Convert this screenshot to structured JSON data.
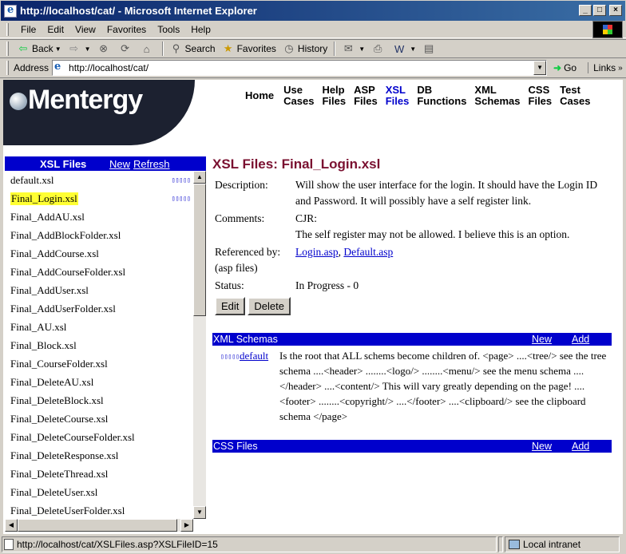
{
  "window": {
    "title": "http://localhost/cat/ - Microsoft Internet Explorer"
  },
  "menu": [
    "File",
    "Edit",
    "View",
    "Favorites",
    "Tools",
    "Help"
  ],
  "toolbar": {
    "back": "Back",
    "search": "Search",
    "favorites": "Favorites",
    "history": "History"
  },
  "address": {
    "label": "Address",
    "url": "http://localhost/cat/",
    "go": "Go",
    "links": "Links"
  },
  "logo": {
    "text": "Mentergy"
  },
  "nav": [
    {
      "line1": "Home",
      "line2": ""
    },
    {
      "line1": "Use",
      "line2": "Cases"
    },
    {
      "line1": "Help",
      "line2": "Files"
    },
    {
      "line1": "ASP",
      "line2": "Files"
    },
    {
      "line1": "XSL",
      "line2": "Files"
    },
    {
      "line1": "DB",
      "line2": "Functions"
    },
    {
      "line1": "XML",
      "line2": "Schemas"
    },
    {
      "line1": "CSS",
      "line2": "Files"
    },
    {
      "line1": "Test",
      "line2": "Cases"
    }
  ],
  "left_panel": {
    "title": "XSL Files",
    "new_label": "New",
    "refresh_label": "Refresh",
    "items": [
      "default.xsl",
      "Final_Login.xsl",
      "Final_AddAU.xsl",
      "Final_AddBlockFolder.xsl",
      "Final_AddCourse.xsl",
      "Final_AddCourseFolder.xsl",
      "Final_AddUser.xsl",
      "Final_AddUserFolder.xsl",
      "Final_AU.xsl",
      "Final_Block.xsl",
      "Final_CourseFolder.xsl",
      "Final_DeleteAU.xsl",
      "Final_DeleteBlock.xsl",
      "Final_DeleteCourse.xsl",
      "Final_DeleteCourseFolder.xsl",
      "Final_DeleteResponse.xsl",
      "Final_DeleteThread.xsl",
      "Final_DeleteUser.xsl",
      "Final_DeleteUserFolder.xsl"
    ],
    "boxes": "▯▯▯▯▯"
  },
  "detail": {
    "title": "XSL Files: Final_Login.xsl",
    "description_label": "Description:",
    "description": "Will show the user interface for the login. It should have the Login ID and Password. It will possibly have a self register link.",
    "comments_label": "Comments:",
    "comments_line1": "CJR:",
    "comments_line2": "The self register may not be allowed. I believe this is an option.",
    "referenced_label": "Referenced by:",
    "referenced_sub": "(asp files)",
    "ref1": "Login.asp",
    "ref2": "Default.asp",
    "status_label": "Status:",
    "status": "In Progress - 0",
    "edit_label": "Edit",
    "delete_label": "Delete"
  },
  "xml_schemas": {
    "title": "XML Schemas",
    "new_label": "New",
    "add_label": "Add",
    "row_name": "default",
    "row_desc": "Is the root that ALL schems become children of. <page> ....<tree/> see the tree schema ....<header> ........<logo/> ........<menu/> see the menu schema ....</header> ....<content/> This will vary greatly depending on the page! ....<footer> ........<copyright/> ....</footer> ....<clipboard/> see the clipboard schema </page>"
  },
  "css_files": {
    "title": "CSS Files",
    "new_label": "New",
    "add_label": "Add"
  },
  "status_bar": {
    "text": "http://localhost/cat/XSLFiles.asp?XSLFileID=15",
    "zone": "Local intranet"
  }
}
